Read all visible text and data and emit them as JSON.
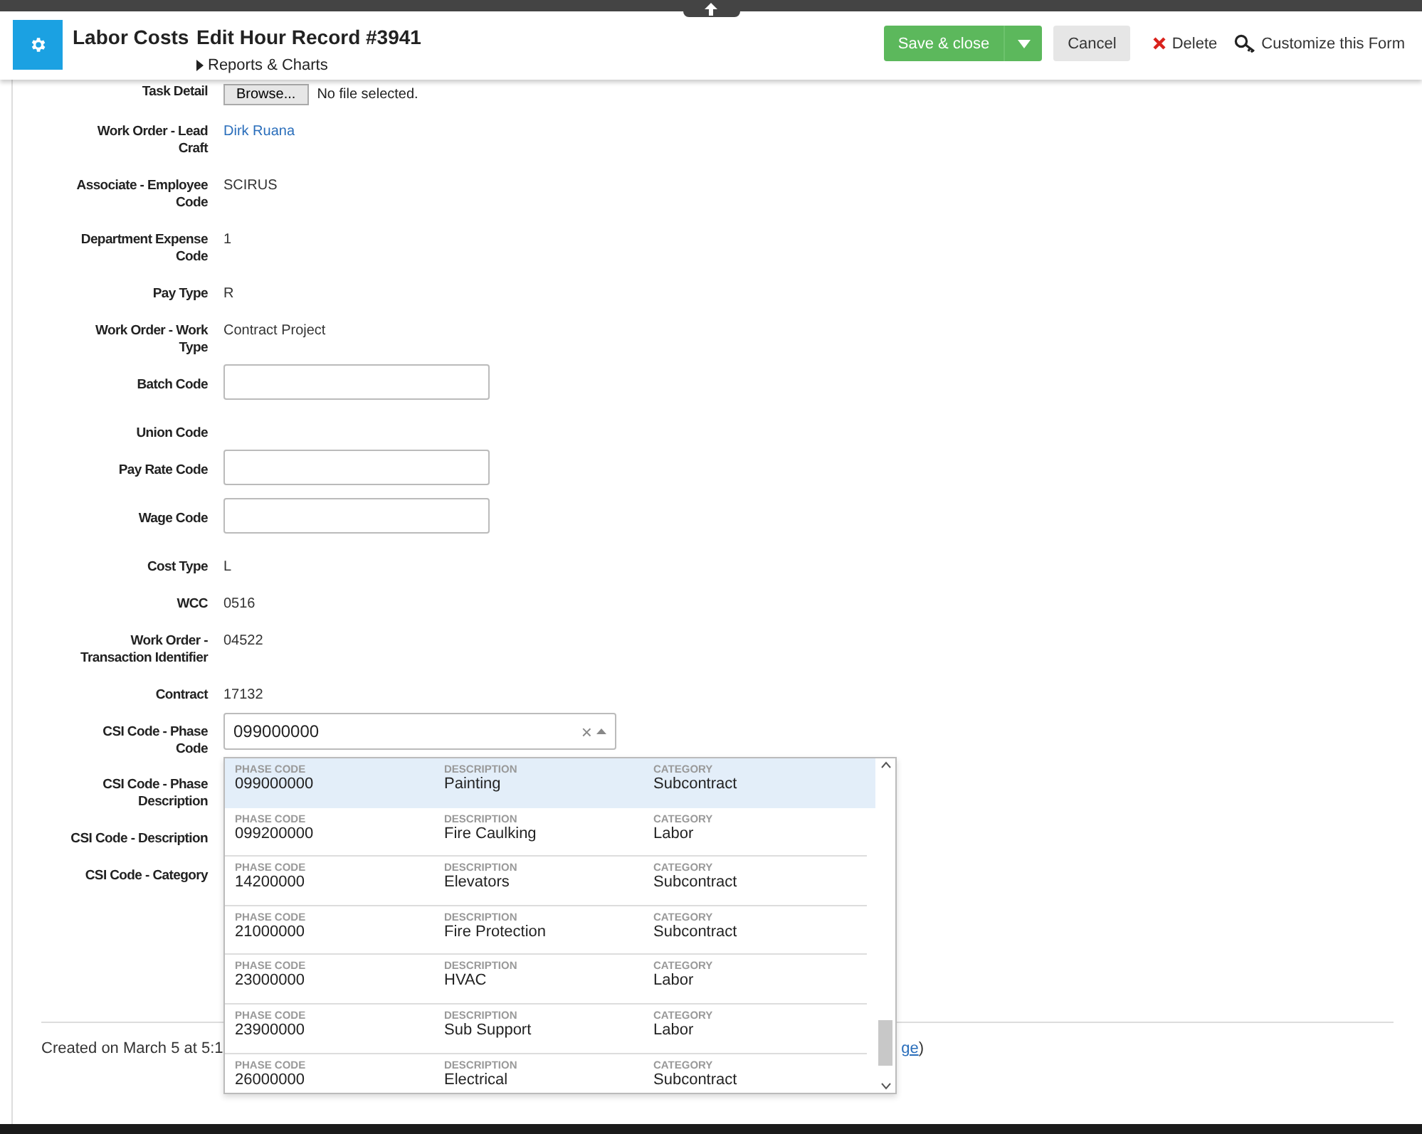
{
  "header": {
    "module": "Labor Costs",
    "title": "Edit Hour Record #3941",
    "submenu": "Reports & Charts",
    "buttons": [
      {
        "kind": "primary",
        "label": "Save & close"
      },
      {
        "kind": "secondary",
        "label": "Cancel"
      },
      {
        "kind": "delete",
        "label": "Delete"
      },
      {
        "kind": "customize",
        "label": "Customize this Form"
      }
    ]
  },
  "fields": [
    {
      "kind": "file",
      "label": "Task Detail",
      "button": "Browse...",
      "value": "No file selected."
    },
    {
      "kind": "link",
      "label": "Work Order - Lead Craft",
      "value": "Dirk Ruana"
    },
    {
      "kind": "text",
      "label": "Associate - Employee Code",
      "value": "SCIRUS"
    },
    {
      "kind": "text",
      "label": "Department Expense Code",
      "value": "1"
    },
    {
      "kind": "text",
      "label": "Pay Type",
      "value": "R"
    },
    {
      "kind": "text",
      "label": "Work Order - Work Type",
      "value": "Contract Project"
    },
    {
      "kind": "input",
      "label": "Batch Code"
    },
    {
      "kind": "text",
      "label": "Union Code"
    },
    {
      "kind": "input",
      "label": "Pay Rate Code"
    },
    {
      "kind": "input",
      "label": "Wage Code"
    },
    {
      "kind": "text",
      "label": "Cost Type",
      "value": "L"
    },
    {
      "kind": "text",
      "label": "WCC",
      "value": "0516"
    },
    {
      "kind": "text",
      "label": "Work Order - Transaction Identifier",
      "value": "04522"
    },
    {
      "kind": "text",
      "label": "Contract",
      "value": "17132"
    },
    {
      "kind": "combo",
      "label": "CSI Code - Phase Code",
      "value": "099000000",
      "clear": "×"
    },
    {
      "kind": "text",
      "label": "CSI Code - Phase Description"
    },
    {
      "kind": "text",
      "label": "CSI Code - Description"
    },
    {
      "kind": "text",
      "label": "CSI Code - Category"
    }
  ],
  "dropdown": {
    "rows": [
      {
        "cells": [
          {
            "caption": "PHASE CODE",
            "value": "099000000"
          },
          {
            "caption": "DESCRIPTION",
            "value": "Painting"
          },
          {
            "caption": "CATEGORY",
            "value": "Subcontract"
          }
        ],
        "selected": true
      },
      {
        "cells": [
          {
            "caption": "PHASE CODE",
            "value": "099200000"
          },
          {
            "caption": "DESCRIPTION",
            "value": "Fire Caulking"
          },
          {
            "caption": "CATEGORY",
            "value": "Labor"
          }
        ],
        "selected": false
      },
      {
        "cells": [
          {
            "caption": "PHASE CODE",
            "value": "14200000"
          },
          {
            "caption": "DESCRIPTION",
            "value": "Elevators"
          },
          {
            "caption": "CATEGORY",
            "value": "Subcontract"
          }
        ],
        "selected": false
      },
      {
        "cells": [
          {
            "caption": "PHASE CODE",
            "value": "21000000"
          },
          {
            "caption": "DESCRIPTION",
            "value": "Fire Protection"
          },
          {
            "caption": "CATEGORY",
            "value": "Subcontract"
          }
        ],
        "selected": false
      },
      {
        "cells": [
          {
            "caption": "PHASE CODE",
            "value": "23000000"
          },
          {
            "caption": "DESCRIPTION",
            "value": "HVAC"
          },
          {
            "caption": "CATEGORY",
            "value": "Labor"
          }
        ],
        "selected": false
      },
      {
        "cells": [
          {
            "caption": "PHASE CODE",
            "value": "23900000"
          },
          {
            "caption": "DESCRIPTION",
            "value": "Sub Support"
          },
          {
            "caption": "CATEGORY",
            "value": "Labor"
          }
        ],
        "selected": false
      },
      {
        "cells": [
          {
            "caption": "PHASE CODE",
            "value": "26000000"
          },
          {
            "caption": "DESCRIPTION",
            "value": "Electrical"
          },
          {
            "caption": "CATEGORY",
            "value": "Subcontract"
          }
        ],
        "selected": false
      }
    ]
  },
  "footer": {
    "text": "Created on March  5 at  5:1",
    "link": "ge",
    "after": ")"
  }
}
